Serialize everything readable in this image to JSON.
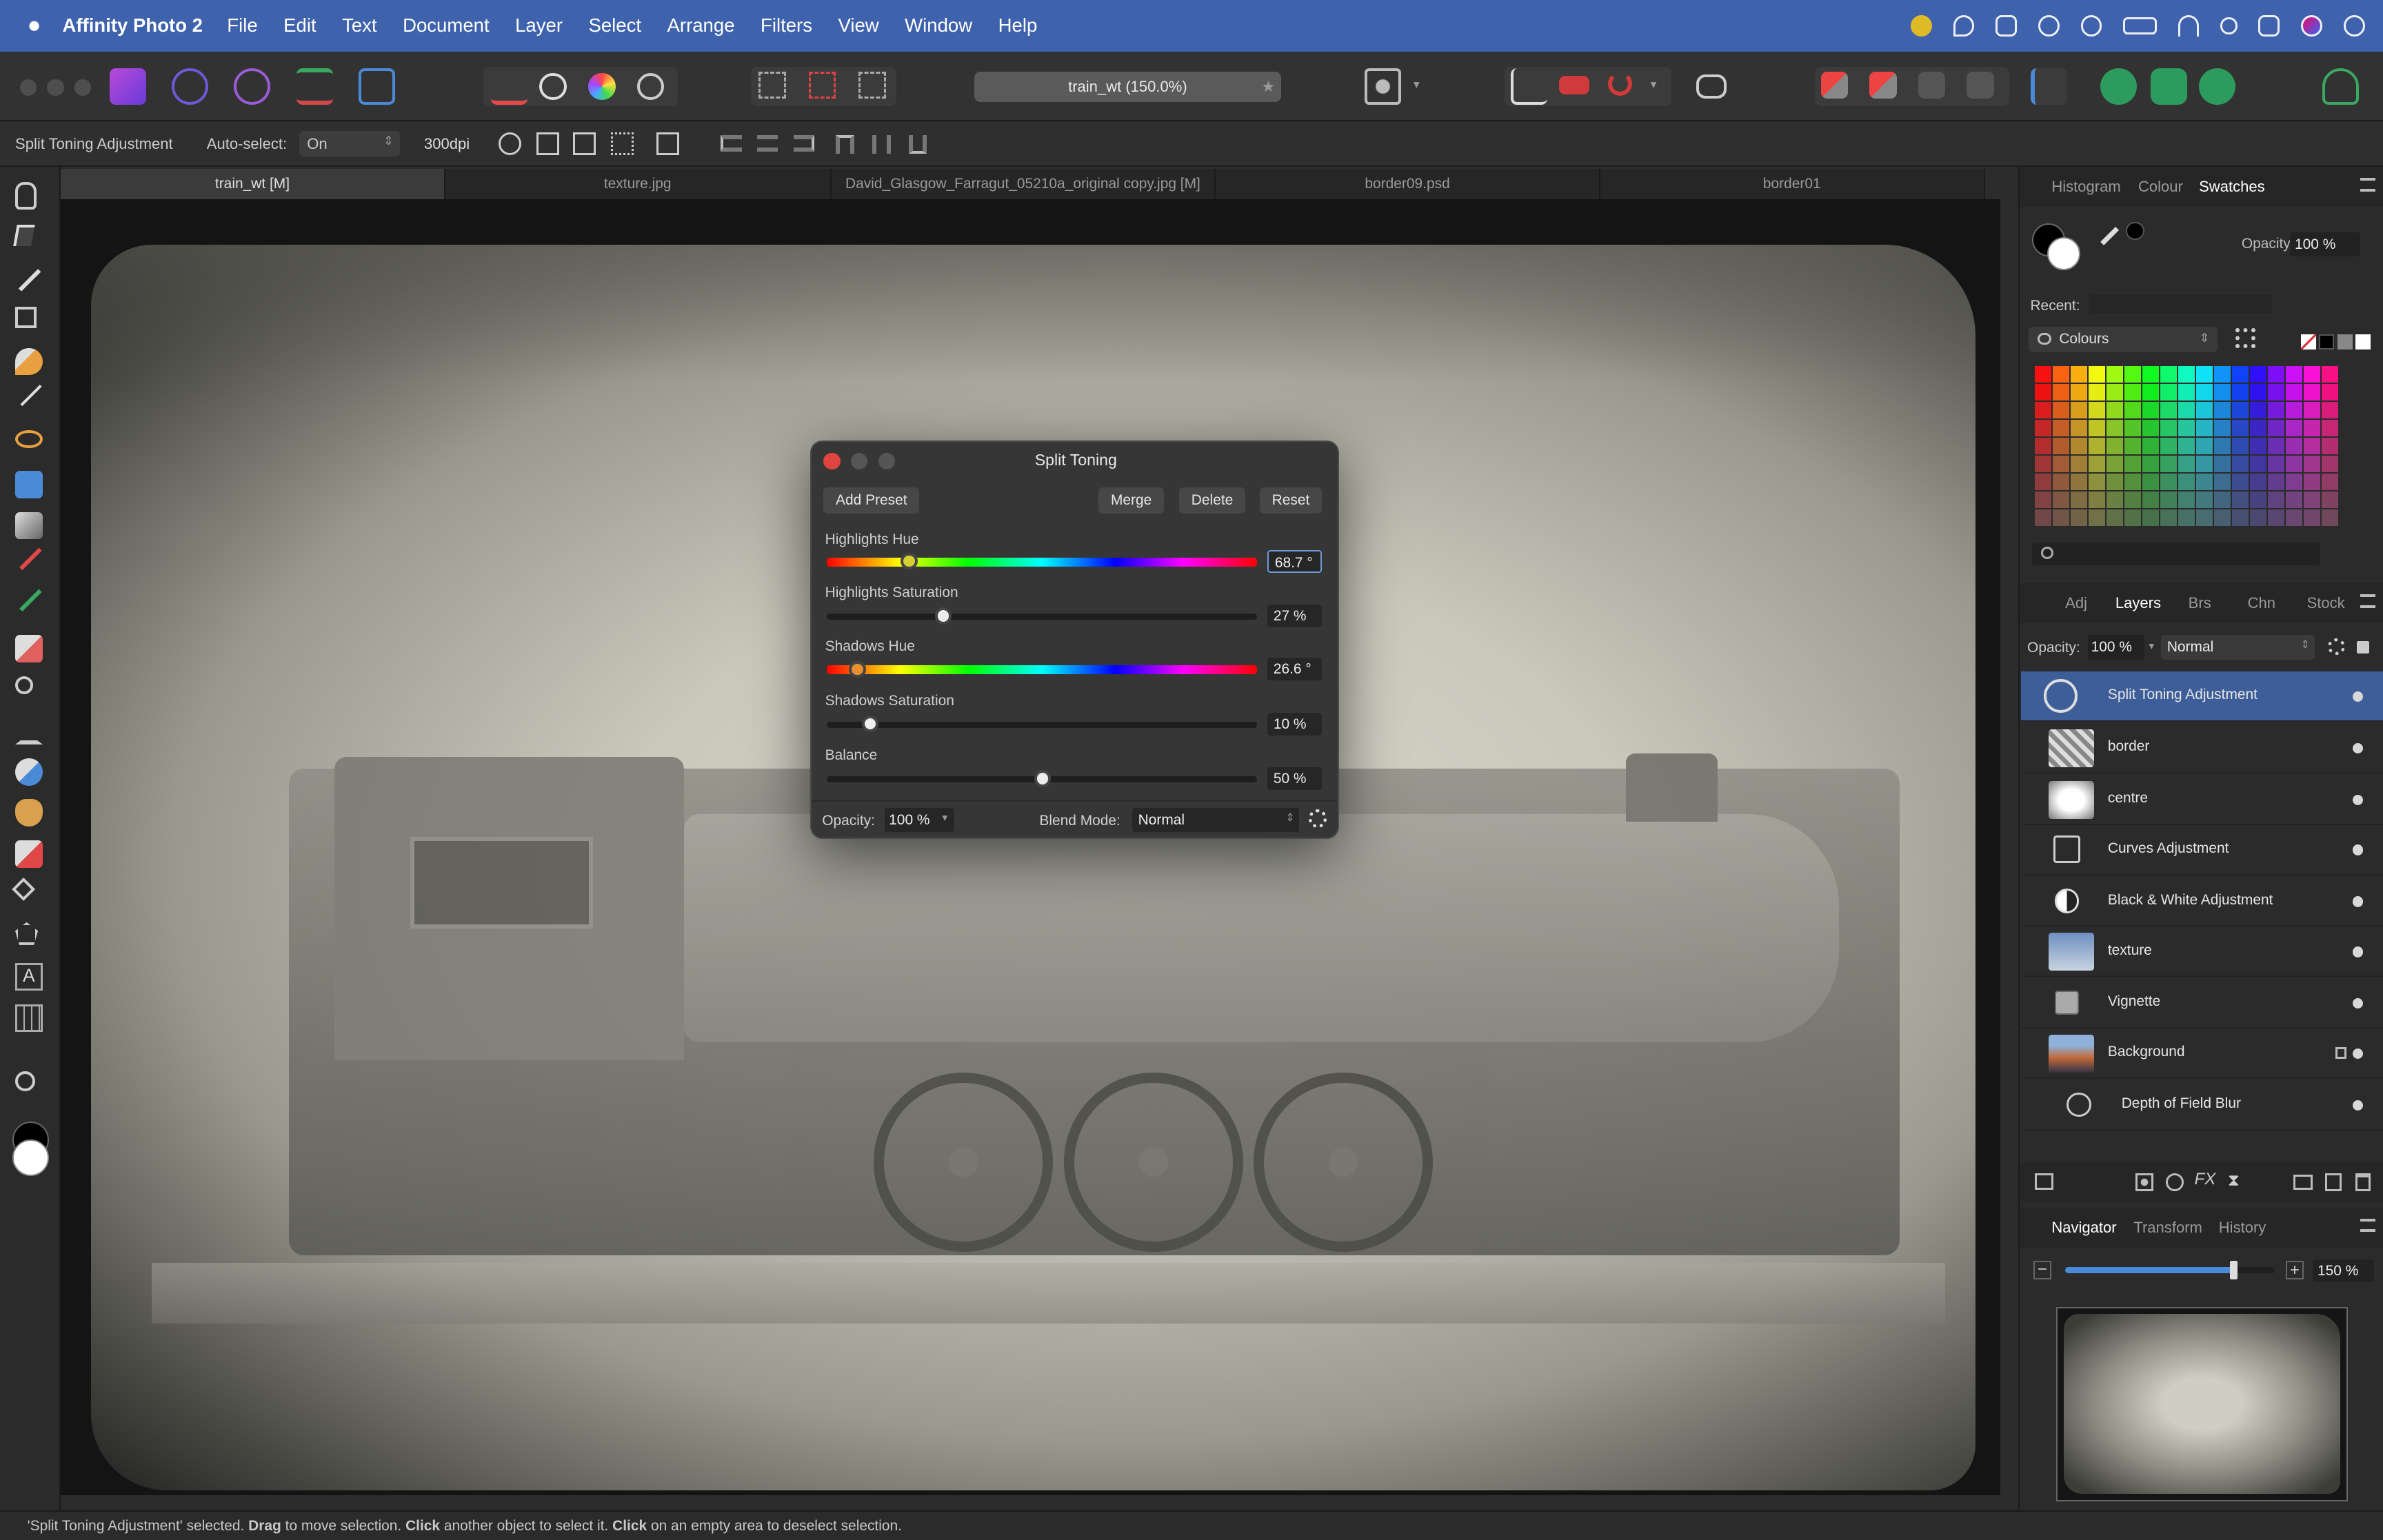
{
  "menubar": {
    "app": "Affinity Photo 2",
    "items": [
      "File",
      "Edit",
      "Text",
      "Document",
      "Layer",
      "Select",
      "Arrange",
      "Filters",
      "View",
      "Window",
      "Help"
    ]
  },
  "toolbar": {
    "doc_title": "train_wt (150.0%)",
    "star": "★"
  },
  "context": {
    "tool_label": "Split Toning Adjustment",
    "autoselect_label": "Auto-select:",
    "autoselect_value": "On",
    "dpi": "300dpi"
  },
  "tabs": [
    "train_wt [M]",
    "texture.jpg",
    "David_Glasgow_Farragut_05210a_original copy.jpg [M]",
    "border09.psd",
    "border01"
  ],
  "dialog": {
    "title": "Split Toning",
    "buttons": {
      "add_preset": "Add Preset",
      "merge": "Merge",
      "delete": "Delete",
      "reset": "Reset"
    },
    "sliders": [
      {
        "label": "Highlights Hue",
        "value": "68.7 °",
        "level": 0.19,
        "hue": true
      },
      {
        "label": "Highlights Saturation",
        "value": "27 %",
        "level": 0.27,
        "hue": false
      },
      {
        "label": "Shadows Hue",
        "value": "26.6 °",
        "level": 0.07,
        "hue": true
      },
      {
        "label": "Shadows Saturation",
        "value": "10 %",
        "level": 0.1,
        "hue": false
      },
      {
        "label": "Balance",
        "value": "50 %",
        "level": 0.5,
        "hue": false
      }
    ],
    "opacity_label": "Opacity:",
    "opacity_value": "100 %",
    "blend_label": "Blend Mode:",
    "blend_value": "Normal"
  },
  "swatches_panel": {
    "tabs": [
      "Histogram",
      "Colour",
      "Swatches"
    ],
    "active": "Swatches",
    "opacity_label": "Opacity:",
    "opacity_value": "100 %",
    "recent_label": "Recent:",
    "palette": "Colours"
  },
  "layers_panel": {
    "tabs": [
      "Adj",
      "Layers",
      "Brs",
      "Chn",
      "Stock"
    ],
    "active": "Layers",
    "opacity_label": "Opacity:",
    "opacity_value": "100 %",
    "blend_value": "Normal",
    "layers": [
      {
        "name": "Split Toning Adjustment",
        "selected": true
      },
      {
        "name": "border",
        "selected": false
      },
      {
        "name": "centre",
        "selected": false
      },
      {
        "name": "Curves Adjustment",
        "selected": false
      },
      {
        "name": "Black & White Adjustment",
        "selected": false
      },
      {
        "name": "texture",
        "selected": false
      },
      {
        "name": "Vignette",
        "selected": false
      },
      {
        "name": "Background",
        "selected": false
      },
      {
        "name": "Depth of Field Blur",
        "selected": false
      }
    ]
  },
  "navigator_panel": {
    "tabs": [
      "Navigator",
      "Transform",
      "History"
    ],
    "active": "Navigator",
    "zoom": "150 %",
    "zoom_level": 0.8
  },
  "status": {
    "p1": "'Split Toning Adjustment' selected. ",
    "b1": "Drag",
    "p2": " to move selection. ",
    "b2": "Click",
    "p3": " another object to select it. ",
    "b3": "Click",
    "p4": " on an empty area to deselect selection."
  }
}
